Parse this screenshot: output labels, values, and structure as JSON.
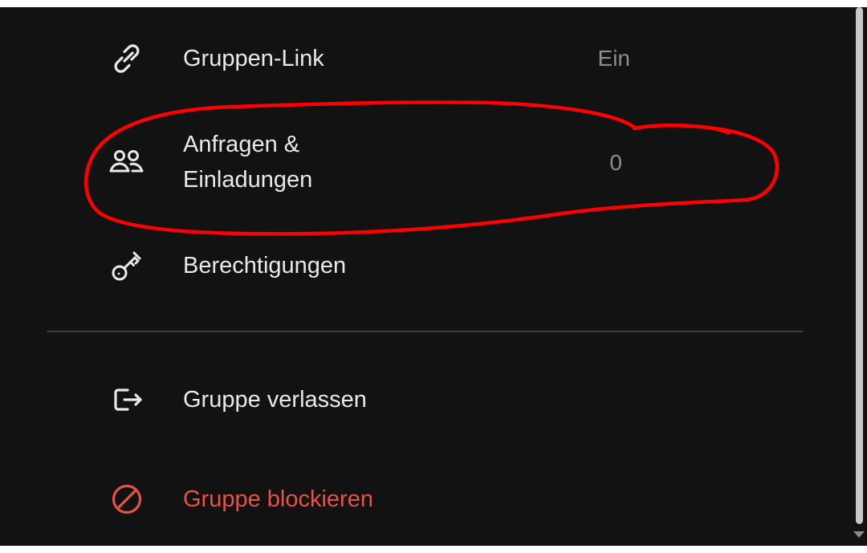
{
  "menu": {
    "group_link": {
      "label": "Gruppen-Link",
      "value": "Ein",
      "icon": "link-icon"
    },
    "requests": {
      "label": "Anfragen & Einladungen",
      "value": "0",
      "icon": "people-icon"
    },
    "permissions": {
      "label": "Berechtigungen",
      "icon": "key-icon"
    },
    "leave": {
      "label": "Gruppe verlassen",
      "icon": "leave-icon"
    },
    "block": {
      "label": "Gruppe blockieren",
      "icon": "block-icon"
    }
  },
  "colors": {
    "background": "#121212",
    "text": "#e9e9e9",
    "secondary_text": "#8d8d8d",
    "danger": "#e5524a",
    "annotation": "#ff0000"
  }
}
